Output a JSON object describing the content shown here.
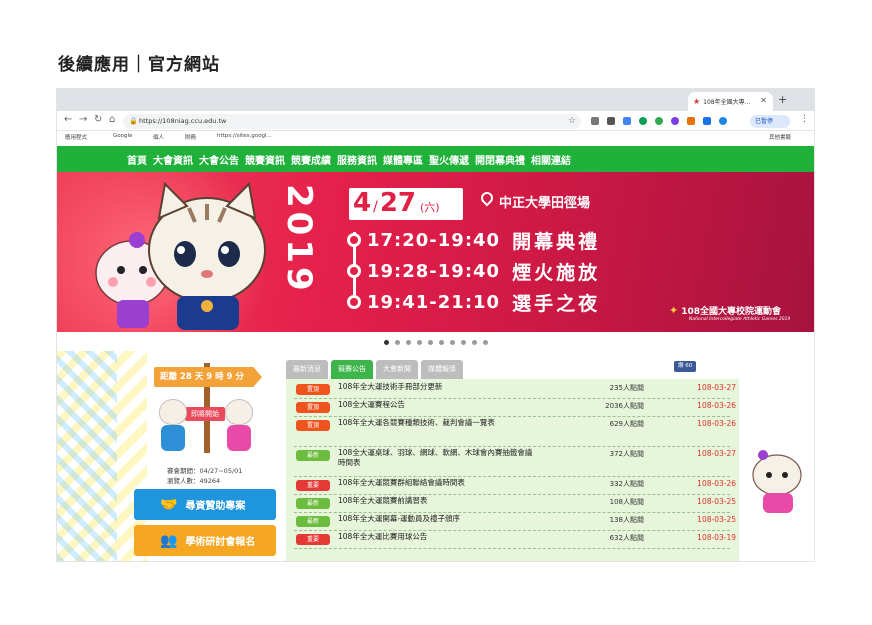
{
  "heading": "後續應用｜官方網站",
  "browser": {
    "tab_title": "108年全國大專...",
    "url": "https://108niag.ccu.edu.tw",
    "profile": "已暫停",
    "bookmarks": [
      "應用程式",
      "Google",
      "個人",
      "財務",
      "https://sites.googl...",
      "其他書籤"
    ]
  },
  "site_nav": [
    "首頁",
    "大會資訊",
    "大會公告",
    "競賽資訊",
    "競賽成績",
    "服務資訊",
    "媒體專區",
    "聖火傳遞",
    "開閉幕典禮",
    "相關連結"
  ],
  "banner": {
    "year": "2019",
    "month": "4",
    "day": "27",
    "weekday": "(六)",
    "venue": "中正大學田徑場",
    "events": [
      {
        "time": "17:20-19:40",
        "name": "開幕典禮"
      },
      {
        "time": "19:28-19:40",
        "name": "煙火施放"
      },
      {
        "time": "19:41-21:10",
        "name": "選手之夜"
      }
    ],
    "logo": "108全國大專校院運動會",
    "logo_sub": "National Intercollegiate Athletic Games 2019"
  },
  "sidebar": {
    "countdown": "距離 28 天 9 時 9 分",
    "sign": "即將開始",
    "event_period": "賽會期間：04/27~05/01",
    "visitors": "瀏覽人數：49264",
    "btn_sponsor": "尋資贊助專案",
    "btn_seminar": "學術研討會報名"
  },
  "news": {
    "tabs": [
      "最新消息",
      "競賽公告",
      "大會新聞",
      "媒體報導"
    ],
    "fb_label": "讚 60",
    "colors": {
      "top": "#f0541e",
      "new": "#6cbc3e",
      "important": "#e53935"
    },
    "items": [
      {
        "badge": "置頂",
        "type": "top",
        "title": "108年全大運技術手冊部分更新",
        "views": "235人點閱",
        "date": "108-03-27"
      },
      {
        "badge": "置頂",
        "type": "top",
        "title": "108全大運賽程公告",
        "views": "2036人點閱",
        "date": "108-03-26"
      },
      {
        "badge": "置頂",
        "type": "top",
        "title": "108年全大運各競賽種類技術、裁判會議一覽表",
        "views": "629人點閱",
        "date": "108-03-26"
      },
      {
        "badge": "最新",
        "type": "new",
        "title": "108全大運桌球、羽球、網球、軟網、木球會內賽抽籤會議時間表",
        "views": "372人點閱",
        "date": "108-03-27"
      },
      {
        "badge": "重要",
        "type": "important",
        "title": "108年全大運競賽群組聯絡會議時間表",
        "views": "332人點閱",
        "date": "108-03-26"
      },
      {
        "badge": "最新",
        "type": "new",
        "title": "108年全大運競賽前講習表",
        "views": "108人點閱",
        "date": "108-03-25"
      },
      {
        "badge": "最新",
        "type": "new",
        "title": "108年全大運開幕-運動員及禮子頒序",
        "views": "138人點閱",
        "date": "108-03-25"
      },
      {
        "badge": "重要",
        "type": "important",
        "title": "108年全大運比賽用球公告",
        "views": "632人點閱",
        "date": "108-03-19"
      }
    ]
  }
}
